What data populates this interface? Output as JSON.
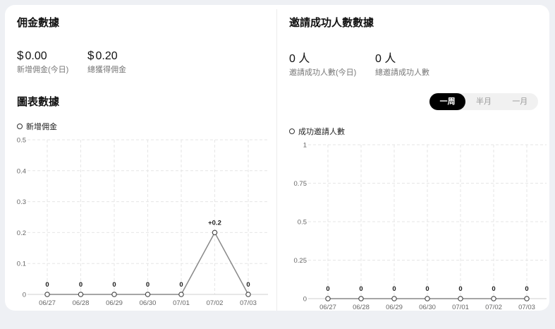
{
  "commission": {
    "title": "佣金數據",
    "currency": "$",
    "today_value": "0.00",
    "today_label": "新增佣金(今日)",
    "total_value": "0.20",
    "total_label": "總獲得佣金",
    "chart_title": "圖表數據"
  },
  "invites": {
    "title": "邀請成功人數數據",
    "today_value": "0 人",
    "today_label": "邀請成功人數(今日)",
    "total_value": "0 人",
    "total_label": "總邀請成功人數"
  },
  "period_toggle": {
    "options": [
      "一周",
      "半月",
      "一月"
    ],
    "selected": "一周"
  },
  "colors": {
    "line": "#888888",
    "grid": "#e6e6e6",
    "accent": "#000000"
  },
  "chart_data": [
    {
      "type": "line",
      "categories": [
        "06/27",
        "06/28",
        "06/29",
        "06/30",
        "07/01",
        "07/02",
        "07/03"
      ],
      "series": [
        {
          "name": "新增佣金",
          "values": [
            0,
            0,
            0,
            0,
            0,
            0.2,
            0
          ]
        }
      ],
      "data_labels": [
        "0",
        "0",
        "0",
        "0",
        "0",
        "+0.2",
        "0"
      ],
      "ylim": [
        0,
        0.5
      ],
      "yticks": [
        "0",
        "0.1",
        "0.2",
        "0.3",
        "0.4",
        "0.5"
      ],
      "grid": true,
      "legend": "top-left"
    },
    {
      "type": "line",
      "categories": [
        "06/27",
        "06/28",
        "06/29",
        "06/30",
        "07/01",
        "07/02",
        "07/03"
      ],
      "series": [
        {
          "name": "成功邀請人數",
          "values": [
            0,
            0,
            0,
            0,
            0,
            0,
            0
          ]
        }
      ],
      "data_labels": [
        "0",
        "0",
        "0",
        "0",
        "0",
        "0",
        "0"
      ],
      "ylim": [
        0,
        1
      ],
      "yticks": [
        "0",
        "0.25",
        "0.5",
        "0.75",
        "1"
      ],
      "grid": true,
      "legend": "top-left"
    }
  ]
}
